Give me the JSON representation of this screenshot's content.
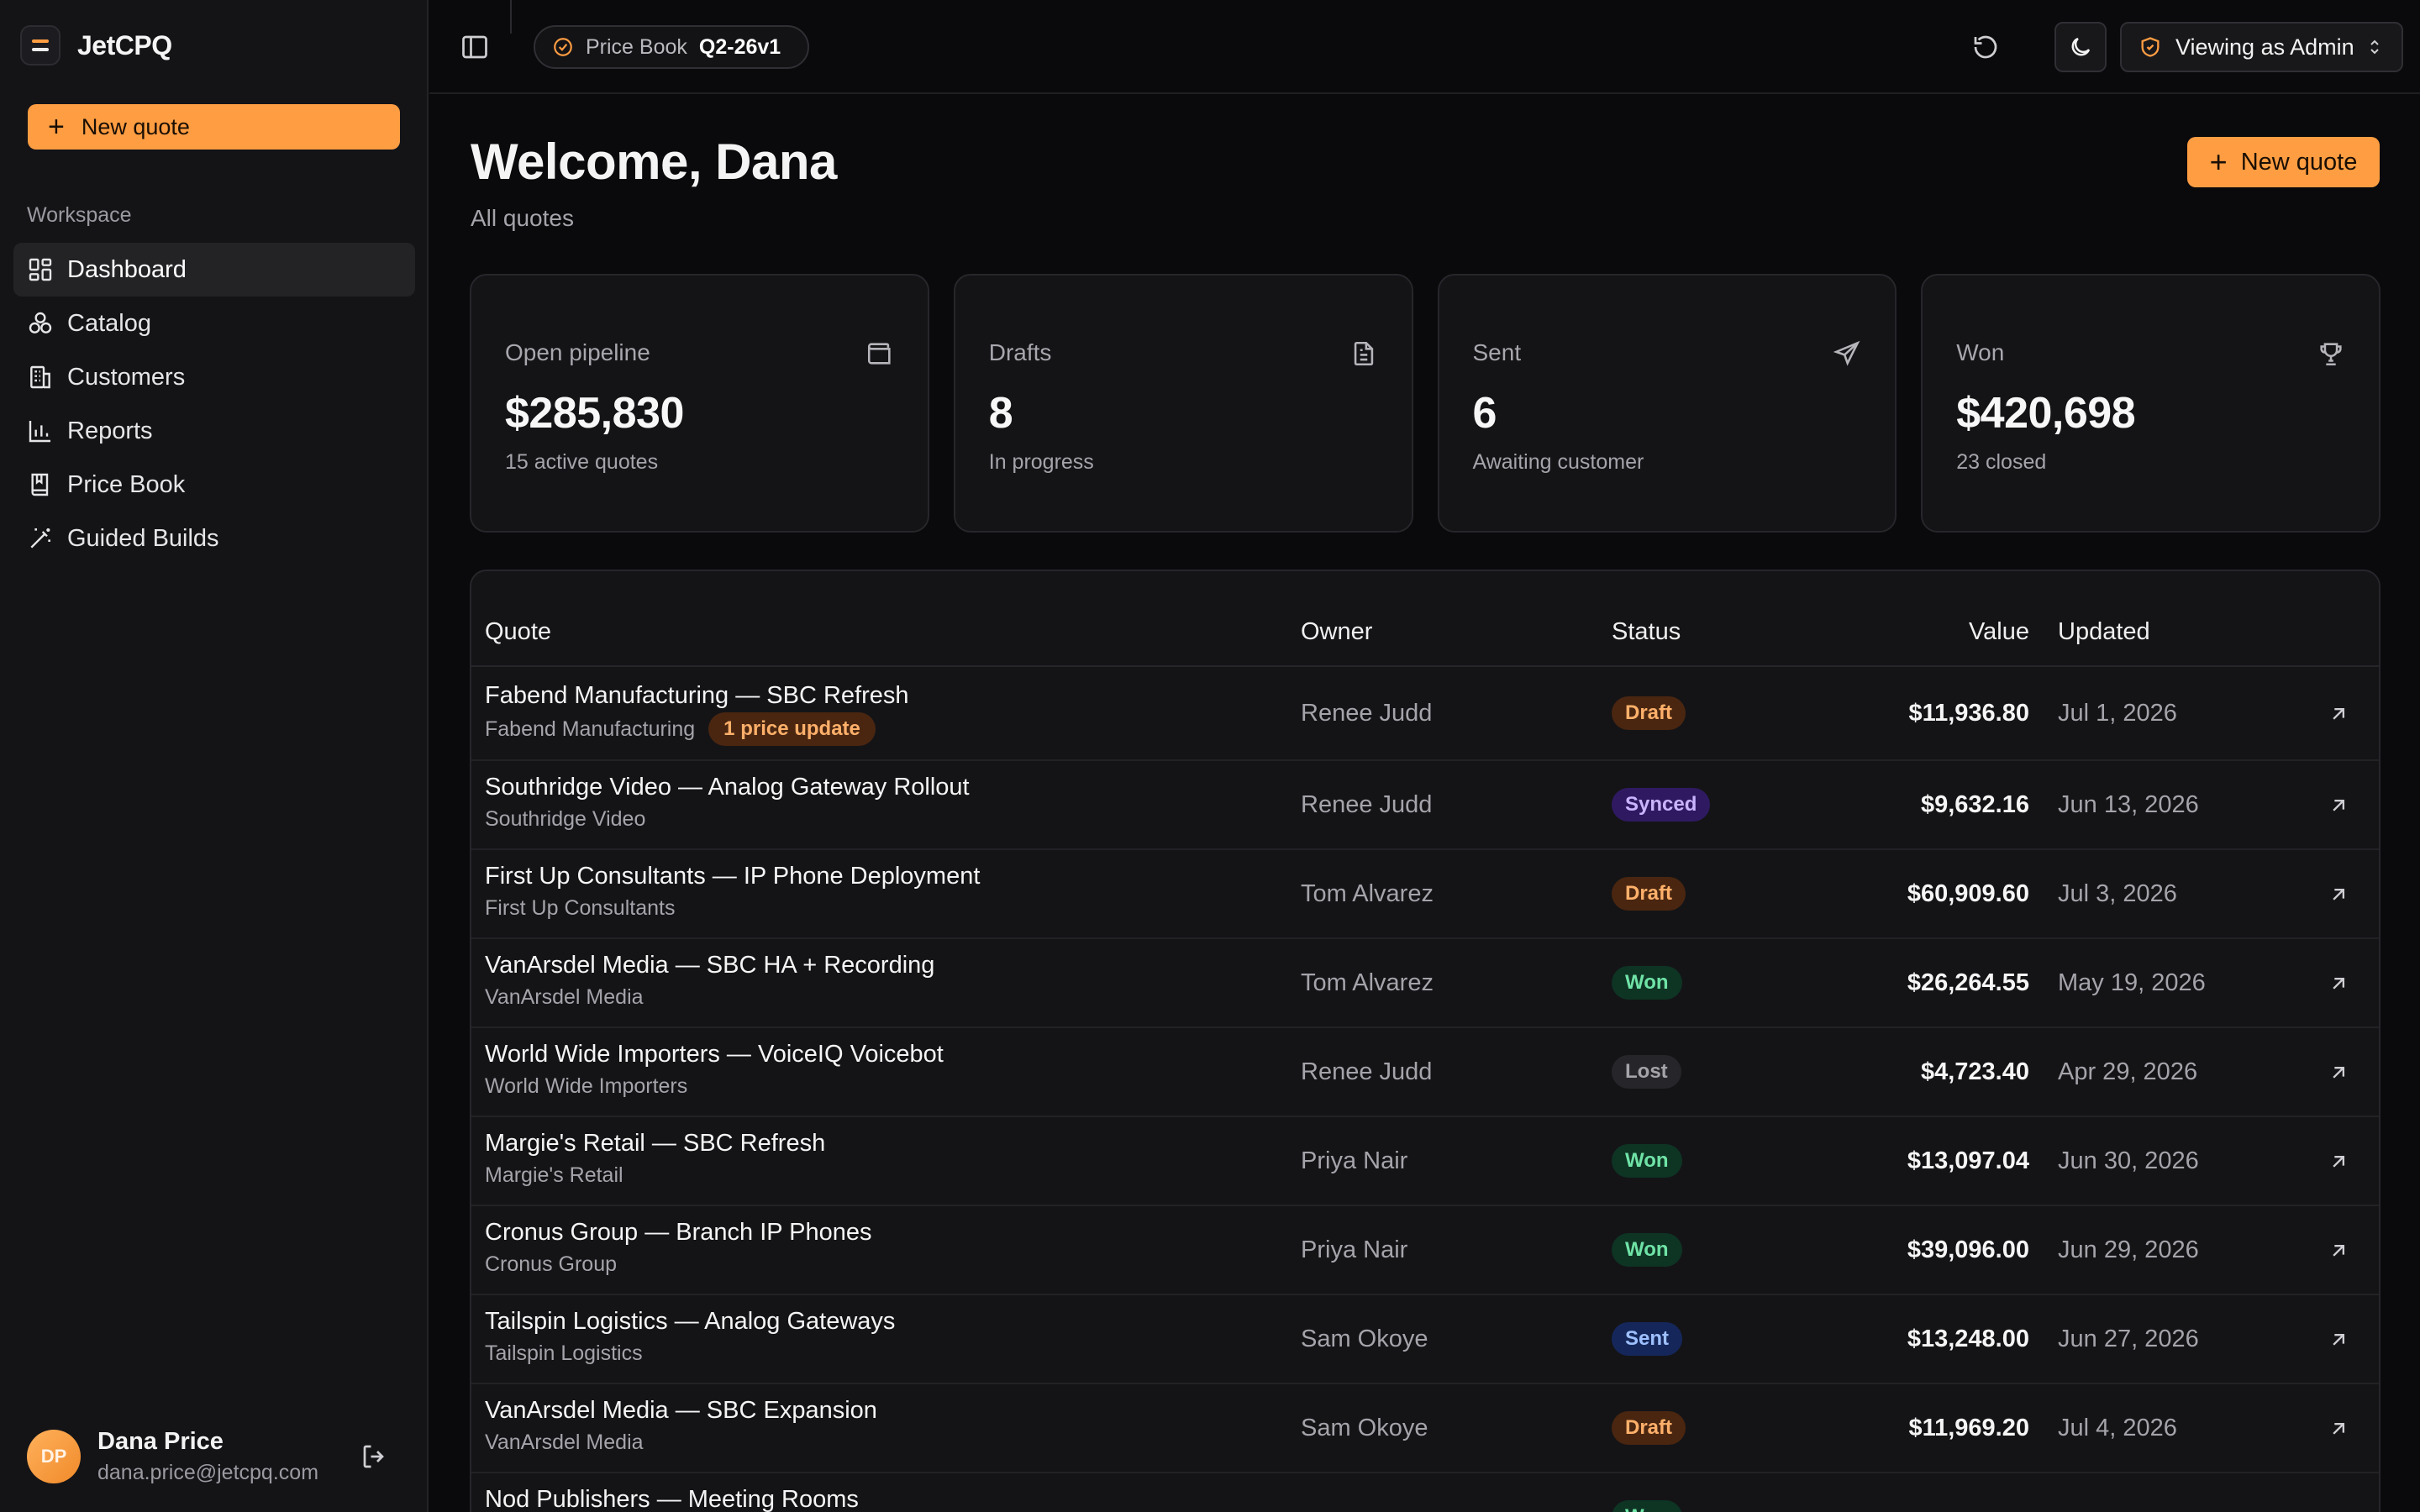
{
  "app": {
    "name": "JetCPQ"
  },
  "sidebar": {
    "new_quote_label": "New quote",
    "section_label": "Workspace",
    "items": [
      {
        "label": "Dashboard",
        "icon": "dashboard-icon",
        "active": true
      },
      {
        "label": "Catalog",
        "icon": "catalog-icon"
      },
      {
        "label": "Customers",
        "icon": "customers-icon"
      },
      {
        "label": "Reports",
        "icon": "reports-icon"
      },
      {
        "label": "Price Book",
        "icon": "price-book-icon"
      },
      {
        "label": "Guided Builds",
        "icon": "wand-icon"
      }
    ],
    "user": {
      "initials": "DP",
      "name": "Dana Price",
      "email": "dana.price@jetcpq.com"
    }
  },
  "topbar": {
    "price_book_label": "Price Book",
    "price_book_version": "Q2-26v1",
    "viewing_as": "Viewing as Admin"
  },
  "main": {
    "title": "Welcome, Dana",
    "subtitle": "All quotes",
    "new_quote_label": "New quote"
  },
  "cards": [
    {
      "label": "Open pipeline",
      "value": "$285,830",
      "sub": "15 active quotes",
      "icon": "wallet-icon"
    },
    {
      "label": "Drafts",
      "value": "8",
      "sub": "In progress",
      "icon": "document-icon"
    },
    {
      "label": "Sent",
      "value": "6",
      "sub": "Awaiting customer",
      "icon": "send-icon"
    },
    {
      "label": "Won",
      "value": "$420,698",
      "sub": "23 closed",
      "icon": "trophy-icon"
    }
  ],
  "table": {
    "headers": {
      "quote": "Quote",
      "owner": "Owner",
      "status": "Status",
      "value": "Value",
      "updated": "Updated"
    },
    "rows": [
      {
        "title": "Fabend Manufacturing — SBC Refresh",
        "customer": "Fabend Manufacturing",
        "note": "1 price update",
        "owner": "Renee Judd",
        "status": "Draft",
        "value": "$11,936.80",
        "updated": "Jul 1, 2026"
      },
      {
        "title": "Southridge Video — Analog Gateway Rollout",
        "customer": "Southridge Video",
        "owner": "Renee Judd",
        "status": "Synced",
        "value": "$9,632.16",
        "updated": "Jun 13, 2026"
      },
      {
        "title": "First Up Consultants — IP Phone Deployment",
        "customer": "First Up Consultants",
        "owner": "Tom Alvarez",
        "status": "Draft",
        "value": "$60,909.60",
        "updated": "Jul 3, 2026"
      },
      {
        "title": "VanArsdel Media — SBC HA + Recording",
        "customer": "VanArsdel Media",
        "owner": "Tom Alvarez",
        "status": "Won",
        "value": "$26,264.55",
        "updated": "May 19, 2026"
      },
      {
        "title": "World Wide Importers — VoiceIQ Voicebot",
        "customer": "World Wide Importers",
        "owner": "Renee Judd",
        "status": "Lost",
        "value": "$4,723.40",
        "updated": "Apr 29, 2026"
      },
      {
        "title": "Margie's Retail — SBC Refresh",
        "customer": "Margie's Retail",
        "owner": "Priya Nair",
        "status": "Won",
        "value": "$13,097.04",
        "updated": "Jun 30, 2026"
      },
      {
        "title": "Cronus Group — Branch IP Phones",
        "customer": "Cronus Group",
        "owner": "Priya Nair",
        "status": "Won",
        "value": "$39,096.00",
        "updated": "Jun 29, 2026"
      },
      {
        "title": "Tailspin Logistics — Analog Gateways",
        "customer": "Tailspin Logistics",
        "owner": "Sam Okoye",
        "status": "Sent",
        "value": "$13,248.00",
        "updated": "Jun 27, 2026"
      },
      {
        "title": "VanArsdel Media — SBC Expansion",
        "customer": "VanArsdel Media",
        "owner": "Sam Okoye",
        "status": "Draft",
        "value": "$11,969.20",
        "updated": "Jul 4, 2026"
      },
      {
        "title": "Nod Publishers — Meeting Rooms",
        "customer": "",
        "owner": "",
        "status": "Won",
        "value": "",
        "updated": ""
      }
    ]
  },
  "colors": {
    "accent": "#ff9d42",
    "background": "#0a0a0c",
    "surface": "#141417"
  }
}
